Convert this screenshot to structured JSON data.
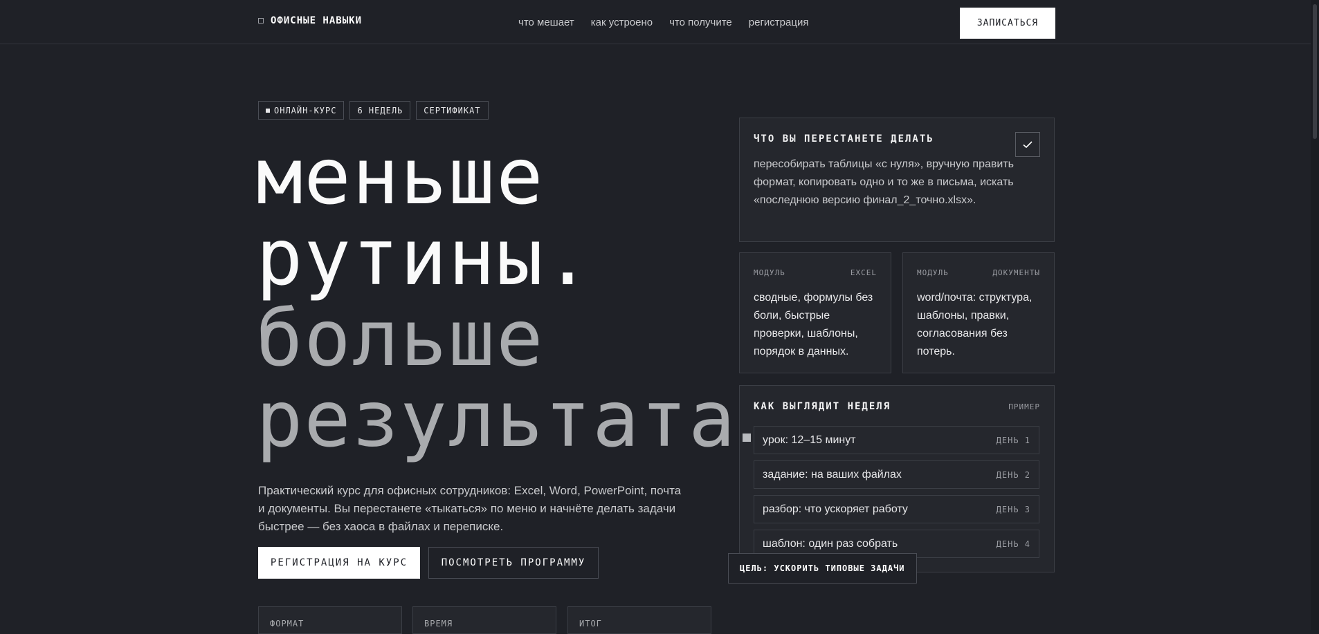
{
  "header": {
    "logo_text": "ОФИСНЫЕ НАВЫКИ",
    "nav": [
      "что мешает",
      "как устроено",
      "что получите",
      "регистрация"
    ],
    "cta": "ЗАПИСАТЬСЯ"
  },
  "tags": [
    "ОНЛАЙН-КУРС",
    "6 НЕДЕЛЬ",
    "СЕРТИФИКАТ"
  ],
  "hero": {
    "line1": "меньше",
    "line2": "рутины.",
    "line3": "больше",
    "line4": "результата"
  },
  "description": "Практический курс для офисных сотрудников: Excel, Word, PowerPoint, почта и документы. Вы перестанете «тыкаться» по меню и начнёте делать задачи быстрее — без хаоса в файлах и переписке.",
  "buttons": {
    "primary": "РЕГИСТРАЦИЯ НА КУРС",
    "secondary": "ПОСМОТРЕТЬ ПРОГРАММУ"
  },
  "stats": [
    "ФОРМАТ",
    "ВРЕМЯ",
    "ИТОГ"
  ],
  "stop_panel": {
    "title": "ЧТО ВЫ ПЕРЕСТАНЕТЕ ДЕЛАТЬ",
    "text": "пересобирать таблицы «с нуля», вручную править формат, копировать одно и то же в письма, искать «последнюю версию финал_2_точно.xlsx».",
    "icon": "check-icon"
  },
  "modules": [
    {
      "label": "МОДУЛЬ",
      "name": "EXCEL",
      "text": "сводные, формулы без боли, быстрые проверки, шаблоны, порядок в данных."
    },
    {
      "label": "МОДУЛЬ",
      "name": "ДОКУМЕНТЫ",
      "text": "word/почта: структура, шаблоны, правки, согласования без потерь."
    }
  ],
  "week": {
    "title": "КАК ВЫГЛЯДИТ НЕДЕЛЯ",
    "tag": "ПРИМЕР",
    "rows": [
      {
        "label": "урок: 12–15 минут",
        "day": "ДЕНЬ 1"
      },
      {
        "label": "задание: на ваших файлах",
        "day": "ДЕНЬ 2"
      },
      {
        "label": "разбор: что ускоряет работу",
        "day": "ДЕНЬ 3"
      },
      {
        "label": "шаблон: один раз собрать",
        "day": "ДЕНЬ 4"
      }
    ]
  },
  "goal": "ЦЕЛЬ: УСКОРИТЬ ТИПОВЫЕ ЗАДАЧИ"
}
